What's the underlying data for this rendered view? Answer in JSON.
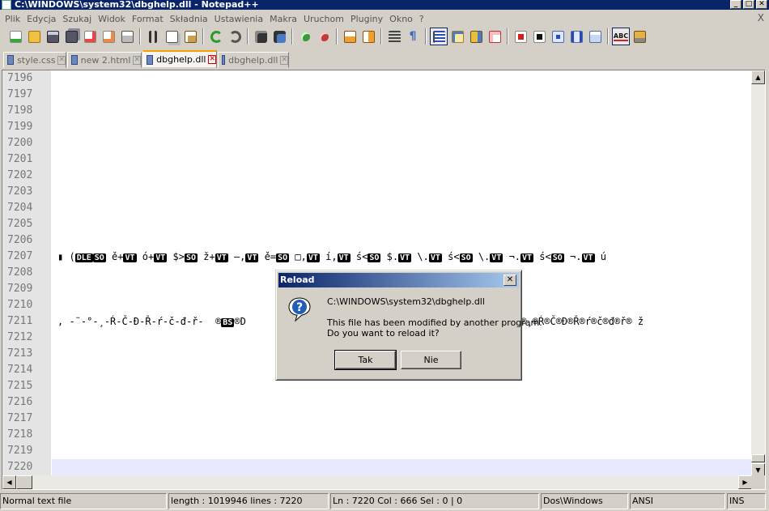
{
  "window": {
    "title": "C:\\WINDOWS\\system32\\dbghelp.dll - Notepad++",
    "controls": [
      "_",
      "□",
      "✕"
    ]
  },
  "menu": {
    "items": [
      "Plik",
      "Edycja",
      "Szukaj",
      "Widok",
      "Format",
      "Składnia",
      "Ustawienia",
      "Makra",
      "Uruchom",
      "Pluginy",
      "Okno",
      "?"
    ],
    "close": "X"
  },
  "toolbar": {
    "icons": [
      "new-file-icon",
      "open-file-icon",
      "save-icon",
      "save-all-icon",
      "close-icon",
      "close-all-icon",
      "print-icon",
      "cut-icon",
      "copy-icon",
      "paste-icon",
      "undo-icon",
      "redo-icon",
      "find-icon",
      "replace-icon",
      "zoom-in-icon",
      "zoom-out-icon",
      "sync-vertical-icon",
      "sync-horizontal-icon",
      "word-wrap-icon",
      "show-all-chars-icon",
      "indent-guide-icon",
      "user-language-icon",
      "function-list-icon",
      "doc-map-icon",
      "record-macro-icon",
      "stop-macro-icon",
      "play-macro-icon",
      "run-macro-multiple-icon",
      "save-macro-icon",
      "spellcheck-icon",
      "extra-icon"
    ]
  },
  "tabs": [
    {
      "label": "style.css",
      "active": false
    },
    {
      "label": "new  2.html",
      "active": false
    },
    {
      "label": "dbghelp.dll",
      "active": true
    },
    {
      "label": "dbghelp.dll",
      "active": false
    }
  ],
  "editor": {
    "lines": [
      {
        "n": "7196",
        "text": ""
      },
      {
        "n": "7197",
        "text": ""
      },
      {
        "n": "7198",
        "text": ""
      },
      {
        "n": "7199",
        "text": ""
      },
      {
        "n": "7200",
        "text": ""
      },
      {
        "n": "7201",
        "text": ""
      },
      {
        "n": "7202",
        "text": ""
      },
      {
        "n": "7203",
        "text": ""
      },
      {
        "n": "7204",
        "text": ""
      },
      {
        "n": "7205",
        "text": ""
      },
      {
        "n": "7206",
        "text": ""
      },
      {
        "n": "7207",
        "text": "▮ (DLESO ě+VT ó+VT $>SO ž+VT –,VT ě=SO □,VT í,VT ś<SO $.VT \\.VT ś<SO \\.VT ¬.VT ś<SO ¬.VT ú"
      },
      {
        "n": "7208",
        "text": ""
      },
      {
        "n": "7209",
        "text": ""
      },
      {
        "n": "7210",
        "text": ""
      },
      {
        "n": "7211",
        "text": ", -¨-°-¸-Ŕ-Č-Đ-Ř-ŕ-č-đ-ř-  ®BS®D                                    □®□®□® ®¨®°®¸®Ŕ®Č®Đ®Ř®ŕ®č®đ®ř® ž"
      },
      {
        "n": "7212",
        "text": ""
      },
      {
        "n": "7213",
        "text": ""
      },
      {
        "n": "7214",
        "text": ""
      },
      {
        "n": "7215",
        "text": ""
      },
      {
        "n": "7216",
        "text": ""
      },
      {
        "n": "7217",
        "text": ""
      },
      {
        "n": "7218",
        "text": ""
      },
      {
        "n": "7219",
        "text": ""
      },
      {
        "n": "7220",
        "text": ""
      }
    ]
  },
  "status": {
    "type": "Normal text file",
    "length": "length : 1019946    lines : 7220",
    "position": "Ln : 7220    Col : 666    Sel : 0 | 0",
    "eol": "Dos\\Windows",
    "encoding": "ANSI",
    "mode": "INS"
  },
  "dialog": {
    "title": "Reload",
    "path": "C:\\WINDOWS\\system32\\dbghelp.dll",
    "message1": "This file has been modified by another program.",
    "message2": "Do you want to reload it?",
    "yes_label": "Tak",
    "no_label": "Nie"
  }
}
